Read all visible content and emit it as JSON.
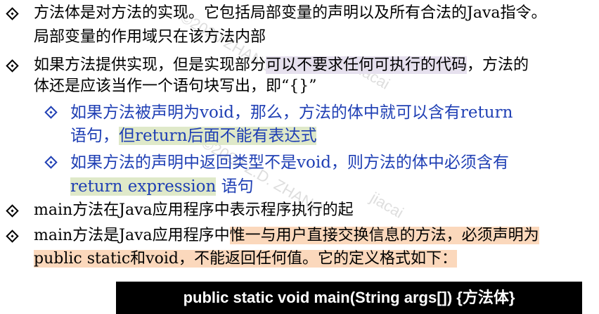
{
  "bullets": [
    {
      "lines": [
        "方法体是对方法的实现。它包括局部变量的声明以及所有合法的Java指令。",
        "局部变量的作用域只在该方法内部"
      ]
    },
    {
      "line1_a": "如果方法提供实现，但是实现部分",
      "line1_b": "可以不要求任何可执行的代码",
      "line1_c": "，方法的",
      "line2": "体还是应该当作一个语句块写出，即“{}”"
    },
    {
      "line1": "如果方法被声明为void，那么，方法的体中就可以含有return",
      "line2_a": "语句，",
      "line2_b": "但return后面不能有表达式"
    },
    {
      "line1": "如果方法的声明中返回类型不是void，则方法的体中必须含有",
      "line2_a": "return expression",
      "line2_b": " 语句"
    },
    {
      "line1": "main方法在Java应用程序中表示程序执行的起"
    },
    {
      "line1_a": "main方法是Java应用程序中",
      "line1_b": "惟一与用户直接交换信息的方法，必须声明为",
      "line2_a": "public static和void",
      "line2_b": "，不能返回任何值。它的定义格式如下："
    }
  ],
  "code": "public static void main(String args[]) {方法体}",
  "watermark": {
    "line1": "©2020 ZHANG",
    "line2": "©2020 Z.D. ZHANG",
    "line3": "Jiacai",
    "line4": "jiacai"
  }
}
